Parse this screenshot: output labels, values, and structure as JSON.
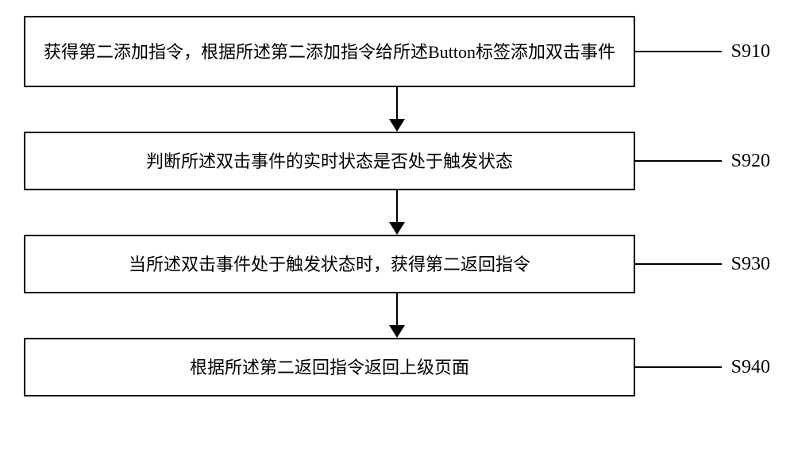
{
  "steps": [
    {
      "text": "获得第二添加指令，根据所述第二添加指令给所述Button标签添加双击事件",
      "label": "S910"
    },
    {
      "text": "判断所述双击事件的实时状态是否处于触发状态",
      "label": "S920"
    },
    {
      "text": "当所述双击事件处于触发状态时，获得第二返回指令",
      "label": "S930"
    },
    {
      "text": "根据所述第二返回指令返回上级页面",
      "label": "S940"
    }
  ]
}
